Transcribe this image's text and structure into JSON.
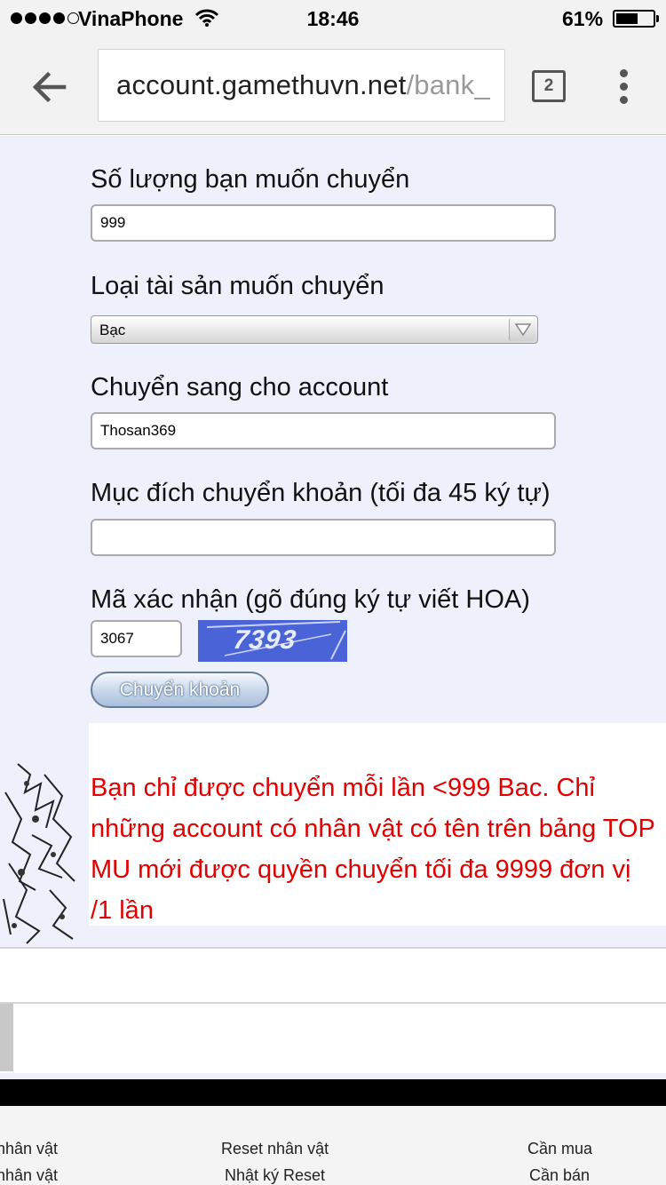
{
  "status_bar": {
    "carrier": "VinaPhone",
    "time": "18:46",
    "battery_percent": "61%",
    "battery_level": 0.61,
    "signal_bars_filled": 4,
    "signal_bars_total": 5
  },
  "browser": {
    "url_host": "account.gamethuvn.net",
    "url_path": "/bank_",
    "tab_count": "2"
  },
  "form": {
    "amount_label": "Số lượng bạn muốn chuyển",
    "amount_value": "999",
    "asset_type_label": "Loại tài sản muốn chuyển",
    "asset_type_value": "Bạc",
    "recipient_label": "Chuyển sang cho account",
    "recipient_value": "Thosan369",
    "purpose_label": "Mục đích chuyển khoản (tối đa 45 ký tự)",
    "purpose_value": "",
    "captcha_label": "Mã xác nhận (gõ đúng ký tự viết HOA)",
    "captcha_value": "3067",
    "captcha_image_text": "7393",
    "submit_label": "Chuyển khoản"
  },
  "notice": {
    "text": "Bạn chỉ được chuyển mỗi lần <999 Bac. Chỉ những account có nhân vật có tên trên bảng TOP MU mới được quyền chuyển tối đa 9999 đơn vị /1 lần"
  },
  "footer": {
    "col1": [
      "nhân vật",
      "nhân vật"
    ],
    "col2": [
      "Reset nhân vật",
      "Nhật ký Reset"
    ],
    "col3": [
      "Cần mua",
      "Cần bán"
    ]
  },
  "colors": {
    "notice_text": "#e00000",
    "page_background": "#eef1fb",
    "captcha_background": "#4a63d6"
  }
}
